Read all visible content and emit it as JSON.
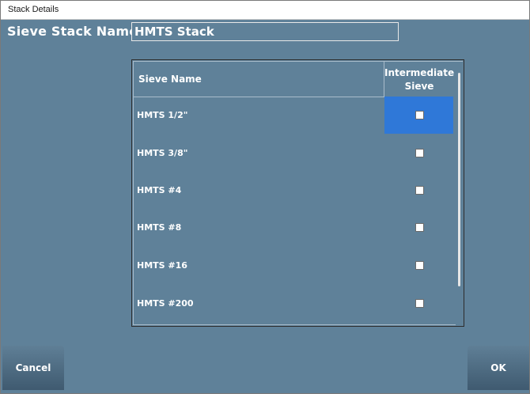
{
  "window": {
    "title": "Stack Details"
  },
  "form": {
    "name_label": "Sieve Stack Name:",
    "name_value": "HMTS Stack"
  },
  "table": {
    "columns": [
      "Sieve Name",
      "Intermediate Sieve"
    ],
    "rows": [
      {
        "name": "HMTS 1/2\"",
        "intermediate": false,
        "selected": true
      },
      {
        "name": "HMTS 3/8\"",
        "intermediate": false,
        "selected": false
      },
      {
        "name": "HMTS #4",
        "intermediate": false,
        "selected": false
      },
      {
        "name": "HMTS #8",
        "intermediate": false,
        "selected": false
      },
      {
        "name": "HMTS #16",
        "intermediate": false,
        "selected": false
      },
      {
        "name": "HMTS #200",
        "intermediate": false,
        "selected": false
      }
    ]
  },
  "buttons": {
    "cancel": "Cancel",
    "ok": "OK"
  },
  "colors": {
    "background": "#5f8199",
    "selected": "#2f78d8"
  }
}
